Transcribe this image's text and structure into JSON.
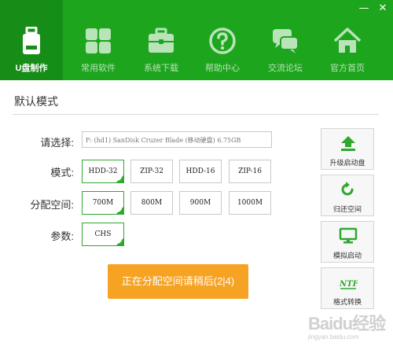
{
  "window_controls": {
    "minimize": "—",
    "close": "✕"
  },
  "nav": {
    "items": [
      {
        "label": "U盘制作",
        "icon": "usb-drive-icon",
        "active": true
      },
      {
        "label": "常用软件",
        "icon": "apps-grid-icon",
        "active": false
      },
      {
        "label": "系统下载",
        "icon": "toolbox-icon",
        "active": false
      },
      {
        "label": "帮助中心",
        "icon": "help-icon",
        "active": false
      },
      {
        "label": "交流论坛",
        "icon": "chat-bubbles-icon",
        "active": false
      },
      {
        "label": "官方首页",
        "icon": "home-icon",
        "active": false
      }
    ]
  },
  "section_title": "默认模式",
  "form": {
    "select_label": "请选择:",
    "device_value": "F: (hd1) SanDisk Cruzer Blade  (移动硬盘) 6.75GB",
    "mode_label": "模式:",
    "modes": [
      "HDD-32",
      "ZIP-32",
      "HDD-16",
      "ZIP-16"
    ],
    "selected_mode": "HDD-32",
    "alloc_label": "分配空间:",
    "allocations": [
      "700M",
      "800M",
      "900M",
      "1000M"
    ],
    "selected_allocation": "700M",
    "param_label": "参数:",
    "params": [
      "CHS"
    ],
    "selected_param": "CHS"
  },
  "start_button": "正在分配空间请稍后(2|4)",
  "tools": [
    {
      "label": "升级启动盘",
      "icon": "upload-arrow-icon"
    },
    {
      "label": "归还空间",
      "icon": "refresh-icon"
    },
    {
      "label": "模拟启动",
      "icon": "monitor-icon"
    },
    {
      "label": "格式转换",
      "icon": "ntfs-icon"
    }
  ],
  "watermark": {
    "text": "Baidu经验",
    "sub": "jingyan.baidu.com"
  },
  "colors": {
    "header_green": "#1ea51e",
    "active_tab": "#168d16",
    "accent_orange": "#f6a324",
    "select_green": "#2fa82f"
  }
}
